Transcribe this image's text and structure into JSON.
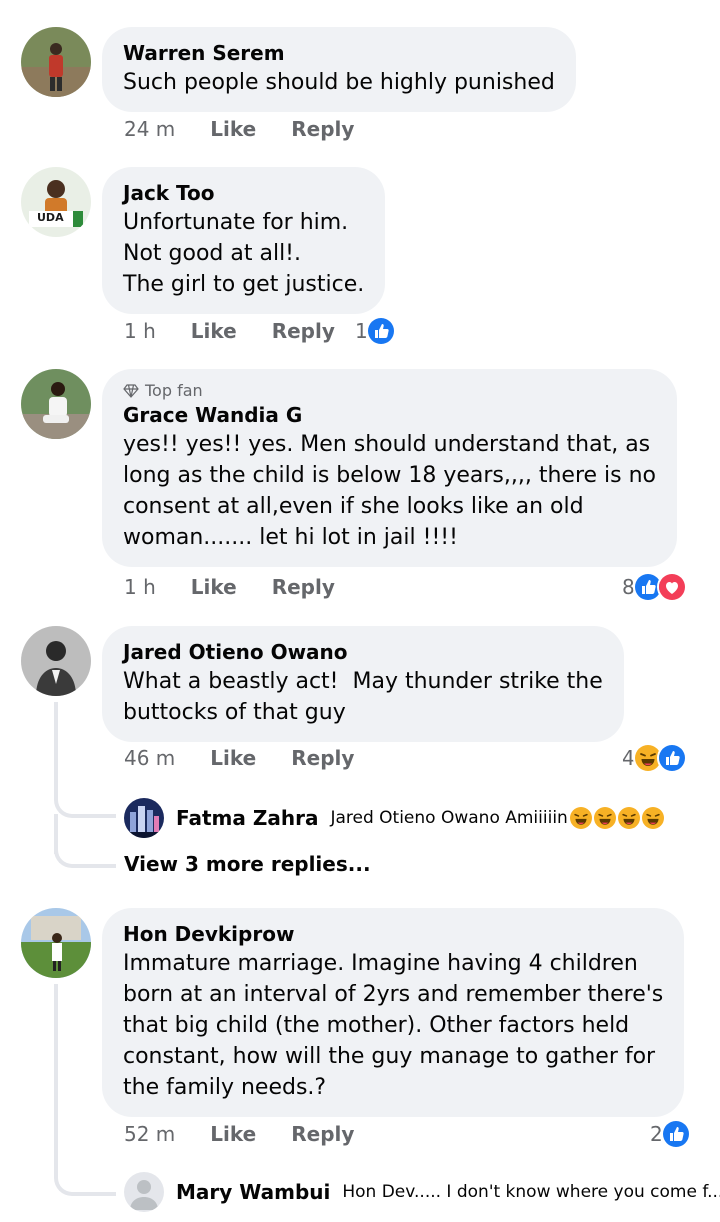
{
  "comments": [
    {
      "name": "Warren Serem",
      "text": "Such people should be highly punished",
      "time": "24 m",
      "like": "Like",
      "reply": "Reply"
    },
    {
      "name": "Jack Too",
      "text": "Unfortunate for him.\nNot good at all!.\nThe girl to get justice.",
      "time": "1 h",
      "like": "Like",
      "reply": "Reply",
      "reactions": "1",
      "avatar_badge": "UDA"
    },
    {
      "badge": "Top fan",
      "name": "Grace Wandia G",
      "text": "yes!! yes!! yes. Men should understand that, as\nlong as the child is below 18 years,,,, there is no\nconsent at all,even if she looks like an old\nwoman....... let hi lot in jail !!!!",
      "time": "1 h",
      "like": "Like",
      "reply": "Reply",
      "reactions": "8"
    },
    {
      "name": "Jared Otieno Owano",
      "text": "What a beastly act!  May thunder strike the\nbuttocks of that guy",
      "time": "46 m",
      "like": "Like",
      "reply": "Reply",
      "reactions": "4",
      "reply_preview": {
        "name": "Fatma Zahra",
        "text": "Jared Otieno Owano Amiiiiin"
      },
      "more_replies": "View 3 more replies..."
    },
    {
      "name": "Hon Devkiprow",
      "text": "Immature marriage. Imagine having 4 children\nborn at an interval of 2yrs and remember there's\nthat big child (the mother). Other factors held\nconstant, how will the guy manage to gather for\nthe family needs.?",
      "time": "52 m",
      "like": "Like",
      "reply": "Reply",
      "reactions": "2",
      "reply_preview": {
        "name": "Mary Wambui",
        "text": "Hon Dev..... I don't know where you come f..."
      }
    }
  ],
  "colors": {
    "like_blue": "#1877f2",
    "love_red": "#f33e58",
    "haha_yellow": "#f7b125",
    "bubble": "#f0f2f5",
    "meta_gray": "#65676b"
  },
  "icons": [
    "like-icon",
    "love-icon",
    "haha-icon",
    "diamond-icon",
    "laughing-emoji-icon"
  ]
}
